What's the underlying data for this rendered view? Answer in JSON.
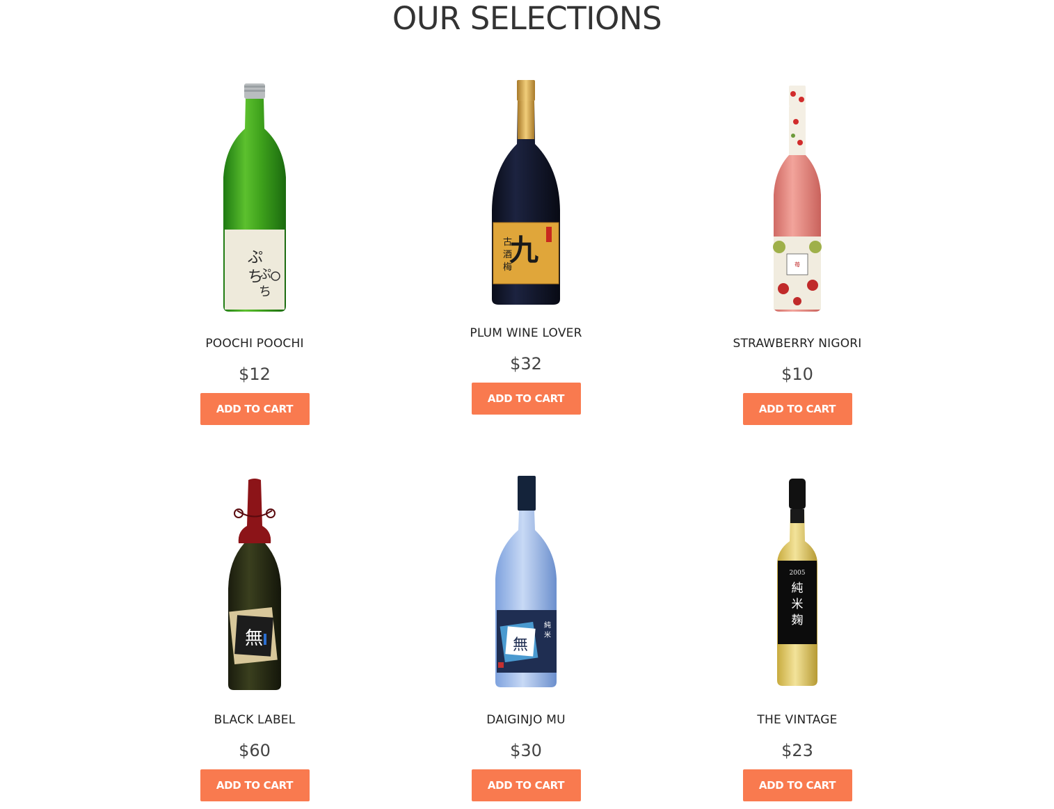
{
  "page": {
    "title": "OUR SELECTIONS"
  },
  "theme": {
    "accent": "#f97a4f"
  },
  "products": [
    {
      "name": "POOCHI POOCHI",
      "price": "$12",
      "button": "ADD TO CART",
      "bottle_icon": "green-sake-bottle-icon"
    },
    {
      "name": "PLUM WINE LOVER",
      "price": "$32",
      "button": "ADD TO CART",
      "bottle_icon": "dark-plum-wine-bottle-icon"
    },
    {
      "name": "STRAWBERRY NIGORI",
      "price": "$10",
      "button": "ADD TO CART",
      "bottle_icon": "pink-strawberry-bottle-icon"
    },
    {
      "name": "BLACK LABEL",
      "price": "$60",
      "button": "ADD TO CART",
      "bottle_icon": "black-label-bottle-icon"
    },
    {
      "name": "DAIGINJO MU",
      "price": "$30",
      "button": "ADD TO CART",
      "bottle_icon": "blue-daiginjo-bottle-icon"
    },
    {
      "name": "THE VINTAGE",
      "price": "$23",
      "button": "ADD TO CART",
      "bottle_icon": "vintage-gold-bottle-icon"
    }
  ]
}
